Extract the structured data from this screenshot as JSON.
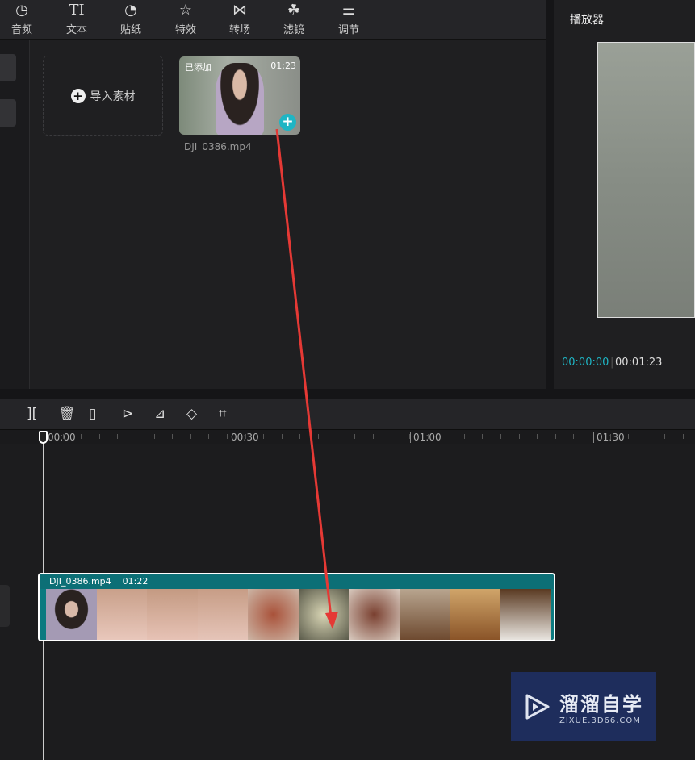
{
  "toolbar": {
    "items": [
      {
        "label": "音频",
        "icon": "music-icon"
      },
      {
        "label": "文本",
        "icon": "text-icon"
      },
      {
        "label": "贴纸",
        "icon": "sticker-icon"
      },
      {
        "label": "特效",
        "icon": "effects-star-icon"
      },
      {
        "label": "转场",
        "icon": "transition-icon"
      },
      {
        "label": "滤镜",
        "icon": "filter-icon"
      },
      {
        "label": "调节",
        "icon": "adjust-sliders-icon"
      }
    ]
  },
  "media": {
    "import_label": "导入素材",
    "item": {
      "badge": "已添加",
      "duration": "01:23",
      "filename": "DJI_0386.mp4"
    }
  },
  "player": {
    "title": "播放器",
    "current_time": "00:00:00",
    "total_time": "00:01:23"
  },
  "timeline": {
    "ruler": [
      "00:00",
      "00:30",
      "01:00",
      "01:30"
    ],
    "clip": {
      "name": "DJI_0386.mp4",
      "duration": "01:22"
    }
  },
  "watermark": {
    "name": "溜溜自学",
    "url": "ZIXUE.3D66.COM"
  },
  "colors": {
    "accent": "#1fb5c4",
    "arrow": "#e53935",
    "clip": "#0b7a80"
  }
}
